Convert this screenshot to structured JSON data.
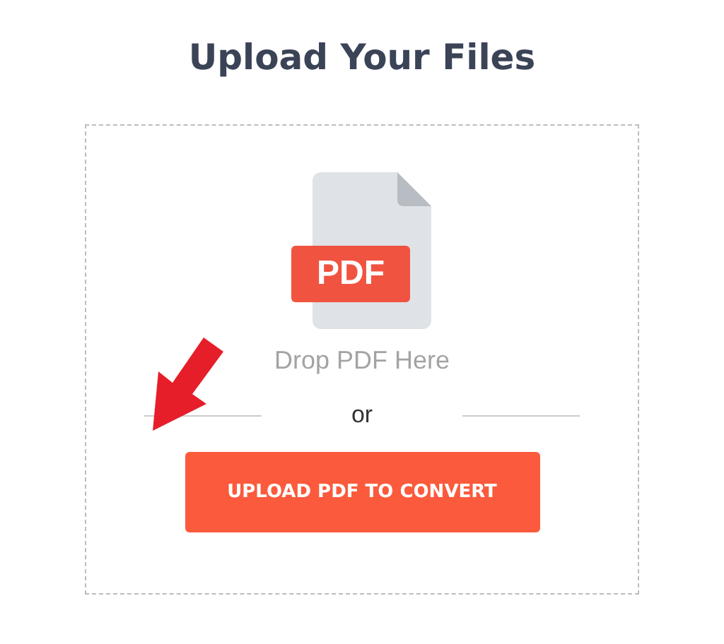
{
  "title": "Upload Your Files",
  "dropzone": {
    "file_label": "PDF",
    "hint": "Drop PDF Here",
    "separator": "or",
    "button": "UPLOAD PDF TO CONVERT"
  }
}
